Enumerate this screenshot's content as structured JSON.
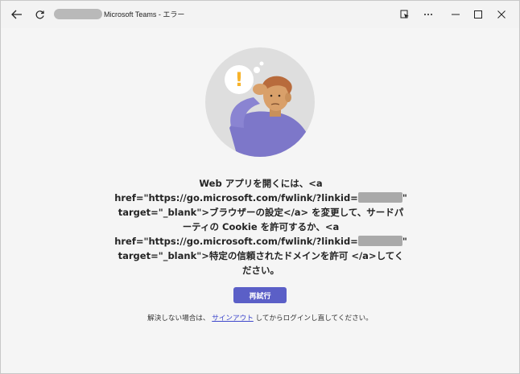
{
  "window": {
    "title": "Microsoft Teams - エラー",
    "icons": [
      "back-arrow-icon",
      "refresh-icon",
      "app-settings-icon",
      "more-icon",
      "minimize-icon",
      "maximize-icon",
      "close-icon"
    ]
  },
  "error": {
    "lines": [
      "Web アプリを開くには、<a",
      "href=\"https://go.microsoft.com/fwlink/?linkid=",
      "target=\"_blank\">ブラウザーの設定</a> を変更して、サードパ",
      "ーティの Cookie を許可するか、<a",
      "href=\"https://go.microsoft.com/fwlink/?linkid=",
      "target=\"_blank\">特定の信頼されたドメインを許可 </a>してく",
      "ださい。"
    ],
    "line2_tail": "\"",
    "line5_tail": "\"",
    "exclamation": "!"
  },
  "retry_button": {
    "label": "再試行"
  },
  "footer": {
    "prefix": "解決しない場合は、",
    "link": "サインアウト",
    "suffix": "してからログインし直してください。"
  },
  "colors": {
    "accent": "#5b5fc7",
    "link": "#3f48cc",
    "illustration_bg": "#dedede",
    "warning": "#f7b32b"
  }
}
